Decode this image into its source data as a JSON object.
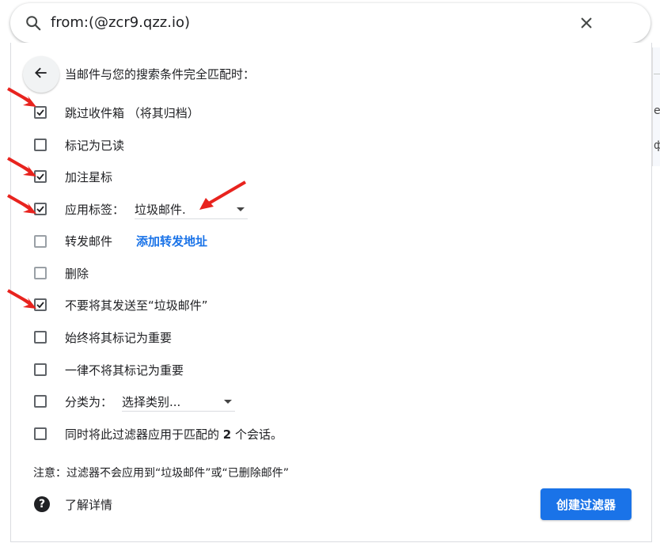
{
  "search": {
    "query": "from:(@zcr9.qzz.io)"
  },
  "header": {
    "text": "当邮件与您的搜索条件完全匹配时："
  },
  "options": [
    {
      "label": "跳过收件箱 （将其归档）",
      "checked": true
    },
    {
      "label": "标记为已读",
      "checked": false
    },
    {
      "label": "加注星标",
      "checked": true
    },
    {
      "label": "应用标签：",
      "checked": true,
      "dropdown": "垃圾邮件."
    },
    {
      "label": "转发邮件",
      "checked": false,
      "link": "添加转发地址"
    },
    {
      "label": "删除",
      "checked": false
    },
    {
      "label": "不要将其发送至“垃圾邮件”",
      "checked": true
    },
    {
      "label": "始终将其标记为重要",
      "checked": false
    },
    {
      "label": "一律不将其标记为重要",
      "checked": false
    },
    {
      "label": "分类为：",
      "checked": false,
      "dropdown": "选择类别..."
    },
    {
      "label_before": "同时将此过滤器应用于匹配的 ",
      "label_bold": "2",
      "label_after": " 个会话。",
      "checked": false
    }
  ],
  "note": "注意：过滤器不会应用到“垃圾邮件”或“已删除邮件”",
  "help": {
    "text": "了解详情",
    "icon": "?"
  },
  "create_button": "创建过滤器",
  "background": {
    "text_fragment_1": "ey",
    "text_fragment_2": "ф"
  },
  "colors": {
    "accent": "#1a73e8",
    "annotation_arrow": "#e8231e"
  },
  "icons": [
    "search-icon",
    "close-icon",
    "arrow-back-icon",
    "checkbox-icon",
    "caret-down-icon",
    "help-icon",
    "annotation-arrow"
  ]
}
